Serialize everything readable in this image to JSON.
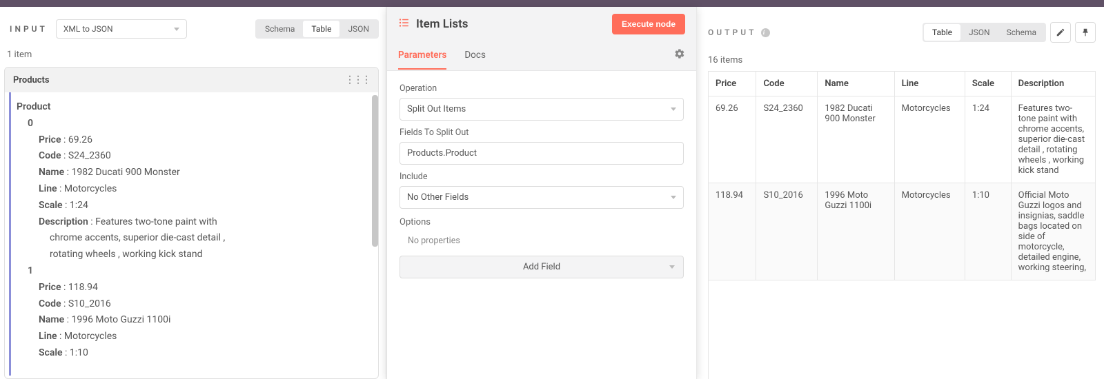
{
  "input": {
    "title": "INPUT",
    "source_select": "XML to JSON",
    "views": [
      "Schema",
      "Table",
      "JSON"
    ],
    "active_view": "Table",
    "count_label": "1 item",
    "root_label": "Products",
    "product_label": "Product",
    "items": [
      {
        "index": "0",
        "fields": {
          "Price": "69.26",
          "Code": "S24_2360",
          "Name": "1982 Ducati 900 Monster",
          "Line": "Motorcycles",
          "Scale": "1:24",
          "Description": "Features two-tone paint with chrome accents, superior die-cast detail , rotating wheels , working kick stand"
        }
      },
      {
        "index": "1",
        "fields": {
          "Price": "118.94",
          "Code": "S10_2016",
          "Name": "1996 Moto Guzzi 1100i",
          "Line": "Motorcycles",
          "Scale": "1:10"
        }
      }
    ]
  },
  "center": {
    "title": "Item Lists",
    "execute_label": "Execute node",
    "tabs": {
      "parameters": "Parameters",
      "docs": "Docs"
    },
    "operation_label": "Operation",
    "operation_value": "Split Out Items",
    "fields_label": "Fields To Split Out",
    "fields_value": "Products.Product",
    "include_label": "Include",
    "include_value": "No Other Fields",
    "options_label": "Options",
    "no_props": "No properties",
    "add_field": "Add Field"
  },
  "output": {
    "title": "OUTPUT",
    "views": [
      "Table",
      "JSON",
      "Schema"
    ],
    "active_view": "Table",
    "count_label": "16 items",
    "columns": [
      "Price",
      "Code",
      "Name",
      "Line",
      "Scale",
      "Description"
    ],
    "rows": [
      {
        "Price": "69.26",
        "Code": "S24_2360",
        "Name": "1982 Ducati 900 Monster",
        "Line": "Motorcycles",
        "Scale": "1:24",
        "Description": "Features two-tone paint with chrome accents, superior die-cast detail , rotating wheels , working kick stand"
      },
      {
        "Price": "118.94",
        "Code": "S10_2016",
        "Name": "1996 Moto Guzzi 1100i",
        "Line": "Motorcycles",
        "Scale": "1:10",
        "Description": "Official Moto Guzzi logos and insignias, saddle bags located on side of motorcycle, detailed engine, working steering,"
      }
    ]
  }
}
